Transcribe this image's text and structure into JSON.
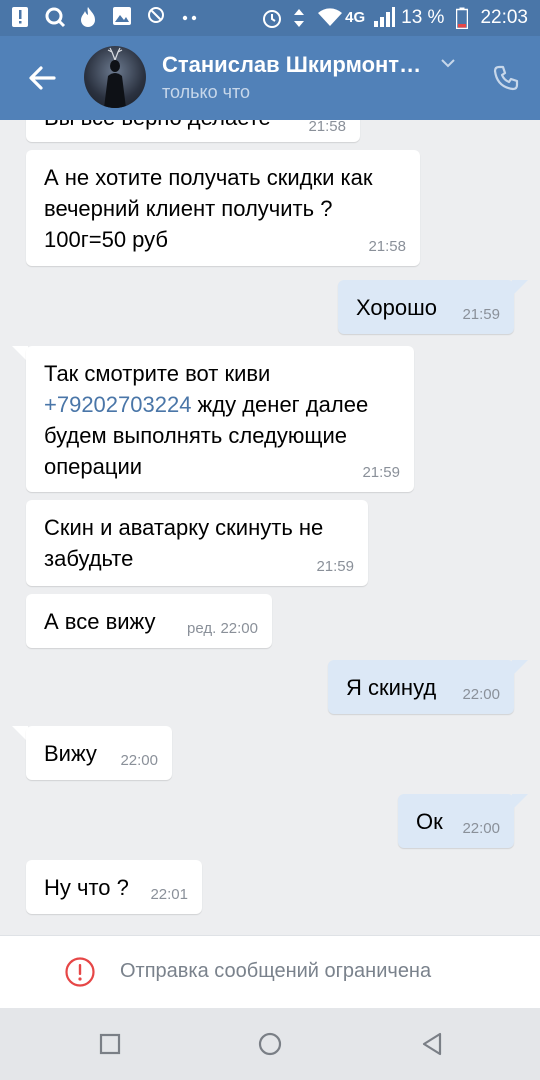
{
  "status_bar": {
    "battery_percent": "13 %",
    "time": "22:03",
    "network": "4G"
  },
  "header": {
    "contact_name": "Станислав Шкирмонт…",
    "last_seen": "только что"
  },
  "messages": [
    {
      "dir": "in",
      "text": "Вы все верно делаете",
      "time": "21:58"
    },
    {
      "dir": "in",
      "text": "А не хотите получать скидки как вечерний клиент получить ? 100г=50 руб",
      "time": "21:58"
    },
    {
      "dir": "out",
      "text": "Хорошо",
      "time": "21:59"
    },
    {
      "dir": "in",
      "text_before": "Так смотрите вот киви ",
      "link": "+79202703224",
      "text_after": " жду денег далее будем выполнять следующие операции",
      "time": "21:59"
    },
    {
      "dir": "in",
      "text": "Скин и аватарку скинуть не забудьте",
      "time": "21:59"
    },
    {
      "dir": "in",
      "text": "А все вижу",
      "time": "ред. 22:00"
    },
    {
      "dir": "out",
      "text": "Я скинуд",
      "time": "22:00"
    },
    {
      "dir": "in",
      "text": "Вижу",
      "time": "22:00"
    },
    {
      "dir": "out",
      "text": "Ок",
      "time": "22:00"
    },
    {
      "dir": "in",
      "text": "Ну что ?",
      "time": "22:01"
    }
  ],
  "restriction": {
    "text": "Отправка сообщений ограничена"
  },
  "icons": {
    "back": "arrow-left-icon",
    "call": "phone-icon",
    "dropdown": "chevron-down-icon",
    "warning": "exclamation-circle-icon",
    "nav": [
      "square-icon",
      "circle-icon",
      "triangle-back-icon"
    ]
  },
  "colors": {
    "header": "#5181b8",
    "status_bar": "#4a76a8",
    "outgoing_bubble": "#dce8f6",
    "incoming_bubble": "#ffffff",
    "link": "#4a76a8",
    "warning": "#e64646"
  }
}
